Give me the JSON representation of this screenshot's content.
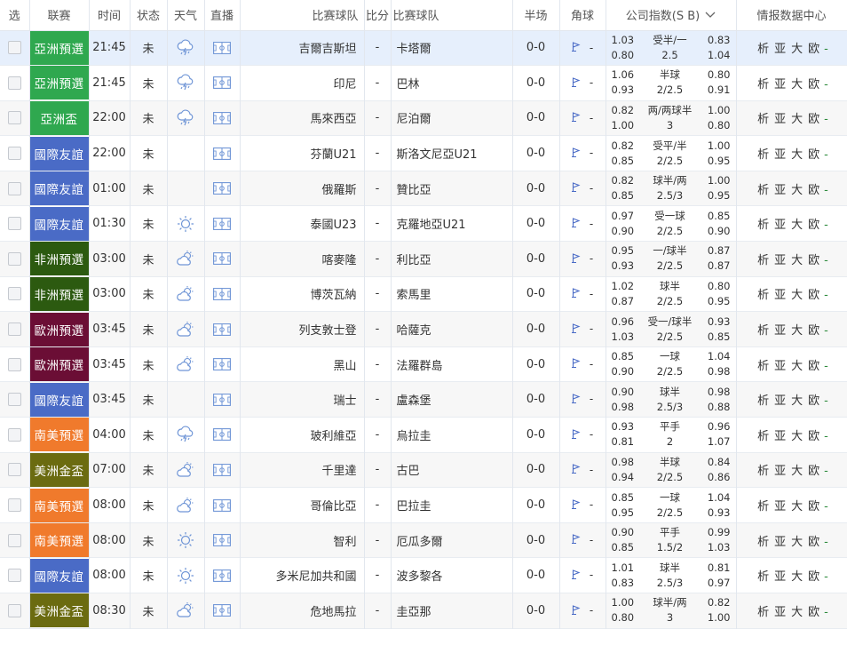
{
  "header": {
    "select": "选",
    "league": "联赛",
    "time": "时间",
    "state": "状态",
    "weather": "天气",
    "live": "直播",
    "home_team": "比赛球队",
    "score": "比分",
    "away_team": "比赛球队",
    "half": "半场",
    "corner": "角球",
    "odds": "公司指数(S B)",
    "info": "情报数据中心"
  },
  "info_links": [
    "析",
    "亚",
    "大",
    "欧"
  ],
  "info_dash": "-",
  "score_sep": "-",
  "rows": [
    {
      "league": "亞洲預選",
      "color": "#2fa84f",
      "time": "21:45",
      "state": "未",
      "weather": "rain",
      "home": "吉爾吉斯坦",
      "away": "卡塔爾",
      "half": "0-0",
      "corner": "-",
      "o1": "1.03",
      "oh": "受半/一",
      "o2": "0.83",
      "o3": "0.80",
      "ob": "2.5",
      "o4": "1.04"
    },
    {
      "league": "亞洲預選",
      "color": "#2fa84f",
      "time": "21:45",
      "state": "未",
      "weather": "rain",
      "home": "印尼",
      "away": "巴林",
      "half": "0-0",
      "corner": "-",
      "o1": "1.06",
      "oh": "半球",
      "o2": "0.80",
      "o3": "0.93",
      "ob": "2/2.5",
      "o4": "0.91"
    },
    {
      "league": "亞洲盃",
      "color": "#2fa84f",
      "time": "22:00",
      "state": "未",
      "weather": "rain",
      "home": "馬來西亞",
      "away": "尼泊爾",
      "half": "0-0",
      "corner": "-",
      "o1": "0.82",
      "oh": "两/两球半",
      "o2": "1.00",
      "o3": "1.00",
      "ob": "3",
      "o4": "0.80"
    },
    {
      "league": "國際友誼",
      "color": "#4a6bc6",
      "time": "22:00",
      "state": "未",
      "weather": "",
      "home": "芬蘭U21",
      "away": "斯洛文尼亞U21",
      "half": "0-0",
      "corner": "-",
      "o1": "0.82",
      "oh": "受平/半",
      "o2": "1.00",
      "o3": "0.85",
      "ob": "2/2.5",
      "o4": "0.95"
    },
    {
      "league": "國際友誼",
      "color": "#4a6bc6",
      "time": "01:00",
      "state": "未",
      "weather": "",
      "home": "俄羅斯",
      "away": "贊比亞",
      "half": "0-0",
      "corner": "-",
      "o1": "0.82",
      "oh": "球半/两",
      "o2": "1.00",
      "o3": "0.85",
      "ob": "2.5/3",
      "o4": "0.95"
    },
    {
      "league": "國際友誼",
      "color": "#4a6bc6",
      "time": "01:30",
      "state": "未",
      "weather": "sun",
      "home": "泰國U23",
      "away": "克羅地亞U21",
      "half": "0-0",
      "corner": "-",
      "o1": "0.97",
      "oh": "受一球",
      "o2": "0.85",
      "o3": "0.90",
      "ob": "2/2.5",
      "o4": "0.90"
    },
    {
      "league": "非洲預選",
      "color": "#2c5a10",
      "time": "03:00",
      "state": "未",
      "weather": "cloud",
      "home": "喀麥隆",
      "away": "利比亞",
      "half": "0-0",
      "corner": "-",
      "o1": "0.95",
      "oh": "一/球半",
      "o2": "0.87",
      "o3": "0.93",
      "ob": "2/2.5",
      "o4": "0.87"
    },
    {
      "league": "非洲預選",
      "color": "#2c5a10",
      "time": "03:00",
      "state": "未",
      "weather": "cloud",
      "home": "博茨瓦納",
      "away": "索馬里",
      "half": "0-0",
      "corner": "-",
      "o1": "1.02",
      "oh": "球半",
      "o2": "0.80",
      "o3": "0.87",
      "ob": "2/2.5",
      "o4": "0.95"
    },
    {
      "league": "歐洲預選",
      "color": "#6b0e35",
      "time": "03:45",
      "state": "未",
      "weather": "cloud",
      "home": "列支敦士登",
      "away": "哈薩克",
      "half": "0-0",
      "corner": "-",
      "o1": "0.96",
      "oh": "受一/球半",
      "o2": "0.93",
      "o3": "1.03",
      "ob": "2/2.5",
      "o4": "0.85"
    },
    {
      "league": "歐洲預選",
      "color": "#6b0e35",
      "time": "03:45",
      "state": "未",
      "weather": "cloud",
      "home": "黑山",
      "away": "法羅群島",
      "half": "0-0",
      "corner": "-",
      "o1": "0.85",
      "oh": "一球",
      "o2": "1.04",
      "o3": "0.90",
      "ob": "2/2.5",
      "o4": "0.98"
    },
    {
      "league": "國際友誼",
      "color": "#4a6bc6",
      "time": "03:45",
      "state": "未",
      "weather": "",
      "home": "瑞士",
      "away": "盧森堡",
      "half": "0-0",
      "corner": "-",
      "o1": "0.90",
      "oh": "球半",
      "o2": "0.98",
      "o3": "0.98",
      "ob": "2.5/3",
      "o4": "0.88"
    },
    {
      "league": "南美預選",
      "color": "#f07a2c",
      "time": "04:00",
      "state": "未",
      "weather": "rain",
      "home": "玻利維亞",
      "away": "烏拉圭",
      "half": "0-0",
      "corner": "-",
      "o1": "0.93",
      "oh": "平手",
      "o2": "0.96",
      "o3": "0.81",
      "ob": "2",
      "o4": "1.07"
    },
    {
      "league": "美洲金盃",
      "color": "#6b6b10",
      "time": "07:00",
      "state": "未",
      "weather": "cloud",
      "home": "千里達",
      "away": "古巴",
      "half": "0-0",
      "corner": "-",
      "o1": "0.98",
      "oh": "半球",
      "o2": "0.84",
      "o3": "0.94",
      "ob": "2/2.5",
      "o4": "0.86"
    },
    {
      "league": "南美預選",
      "color": "#f07a2c",
      "time": "08:00",
      "state": "未",
      "weather": "cloud",
      "home": "哥倫比亞",
      "away": "巴拉圭",
      "half": "0-0",
      "corner": "-",
      "o1": "0.85",
      "oh": "一球",
      "o2": "1.04",
      "o3": "0.95",
      "ob": "2/2.5",
      "o4": "0.93"
    },
    {
      "league": "南美預選",
      "color": "#f07a2c",
      "time": "08:00",
      "state": "未",
      "weather": "sun",
      "home": "智利",
      "away": "厄瓜多爾",
      "half": "0-0",
      "corner": "-",
      "o1": "0.90",
      "oh": "平手",
      "o2": "0.99",
      "o3": "0.85",
      "ob": "1.5/2",
      "o4": "1.03"
    },
    {
      "league": "國際友誼",
      "color": "#4a6bc6",
      "time": "08:00",
      "state": "未",
      "weather": "sun",
      "home": "多米尼加共和國",
      "away": "波多黎各",
      "half": "0-0",
      "corner": "-",
      "o1": "1.01",
      "oh": "球半",
      "o2": "0.81",
      "o3": "0.83",
      "ob": "2.5/3",
      "o4": "0.97"
    },
    {
      "league": "美洲金盃",
      "color": "#6b6b10",
      "time": "08:30",
      "state": "未",
      "weather": "cloud",
      "home": "危地馬拉",
      "away": "圭亞那",
      "half": "0-0",
      "corner": "-",
      "o1": "1.00",
      "oh": "球半/两",
      "o2": "0.82",
      "o3": "0.80",
      "ob": "3",
      "o4": "1.00"
    }
  ]
}
